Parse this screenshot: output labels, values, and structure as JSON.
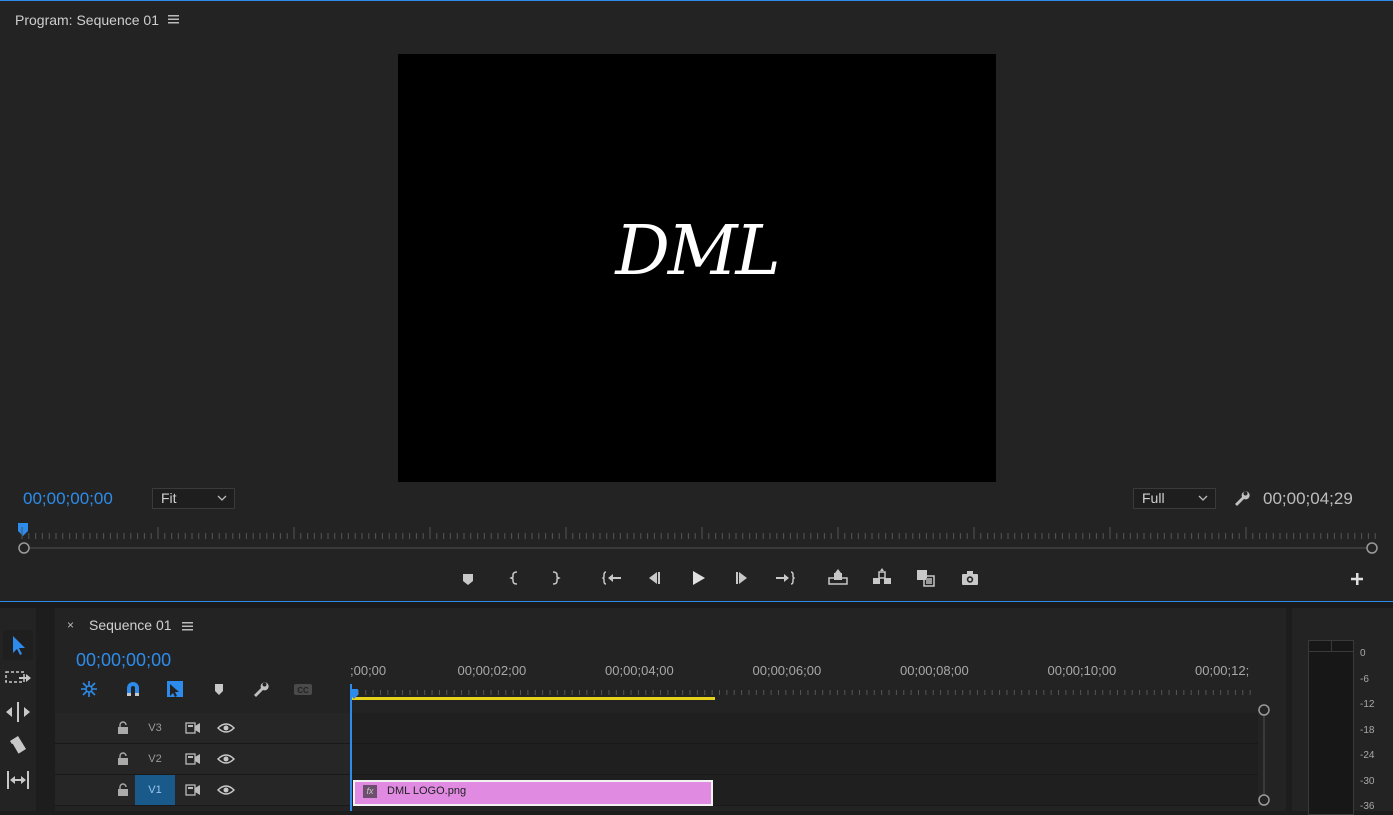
{
  "program_monitor": {
    "title": "Program: Sequence 01",
    "video_text": "DML",
    "current_timecode": "00;00;00;00",
    "zoom_label": "Fit",
    "resolution_label": "Full",
    "duration_timecode": "00;00;04;29"
  },
  "transport_icons": [
    "add-marker-icon",
    "mark-in-icon",
    "mark-out-icon",
    "go-to-in-icon",
    "step-back-icon",
    "play-icon",
    "step-forward-icon",
    "go-to-out-icon",
    "lift-icon",
    "extract-icon",
    "export-frame-compare-icon",
    "camera-icon",
    "add-icon"
  ],
  "timeline": {
    "tab_title": "Sequence 01",
    "close_glyph": "×",
    "timecode": "00;00;00;00",
    "ruler_labels": [
      ";00;00",
      "00;00;02;00",
      "00;00;04;00",
      "00;00;06;00",
      "00;00;08;00",
      "00;00;10;00",
      "00;00;12;"
    ],
    "tracks": [
      {
        "label": "V3"
      },
      {
        "label": "V2"
      },
      {
        "label": "V1"
      }
    ],
    "clip": {
      "name": "DML LOGO.png",
      "fx": "fx"
    }
  },
  "meter": {
    "db_labels": [
      "0",
      "-6",
      "-12",
      "-18",
      "-24",
      "-30",
      "-36"
    ]
  },
  "colors": {
    "accent": "#2d8ceb",
    "clip": "#e08ae1",
    "work_area": "#e6d21a",
    "panel": "#232323"
  }
}
